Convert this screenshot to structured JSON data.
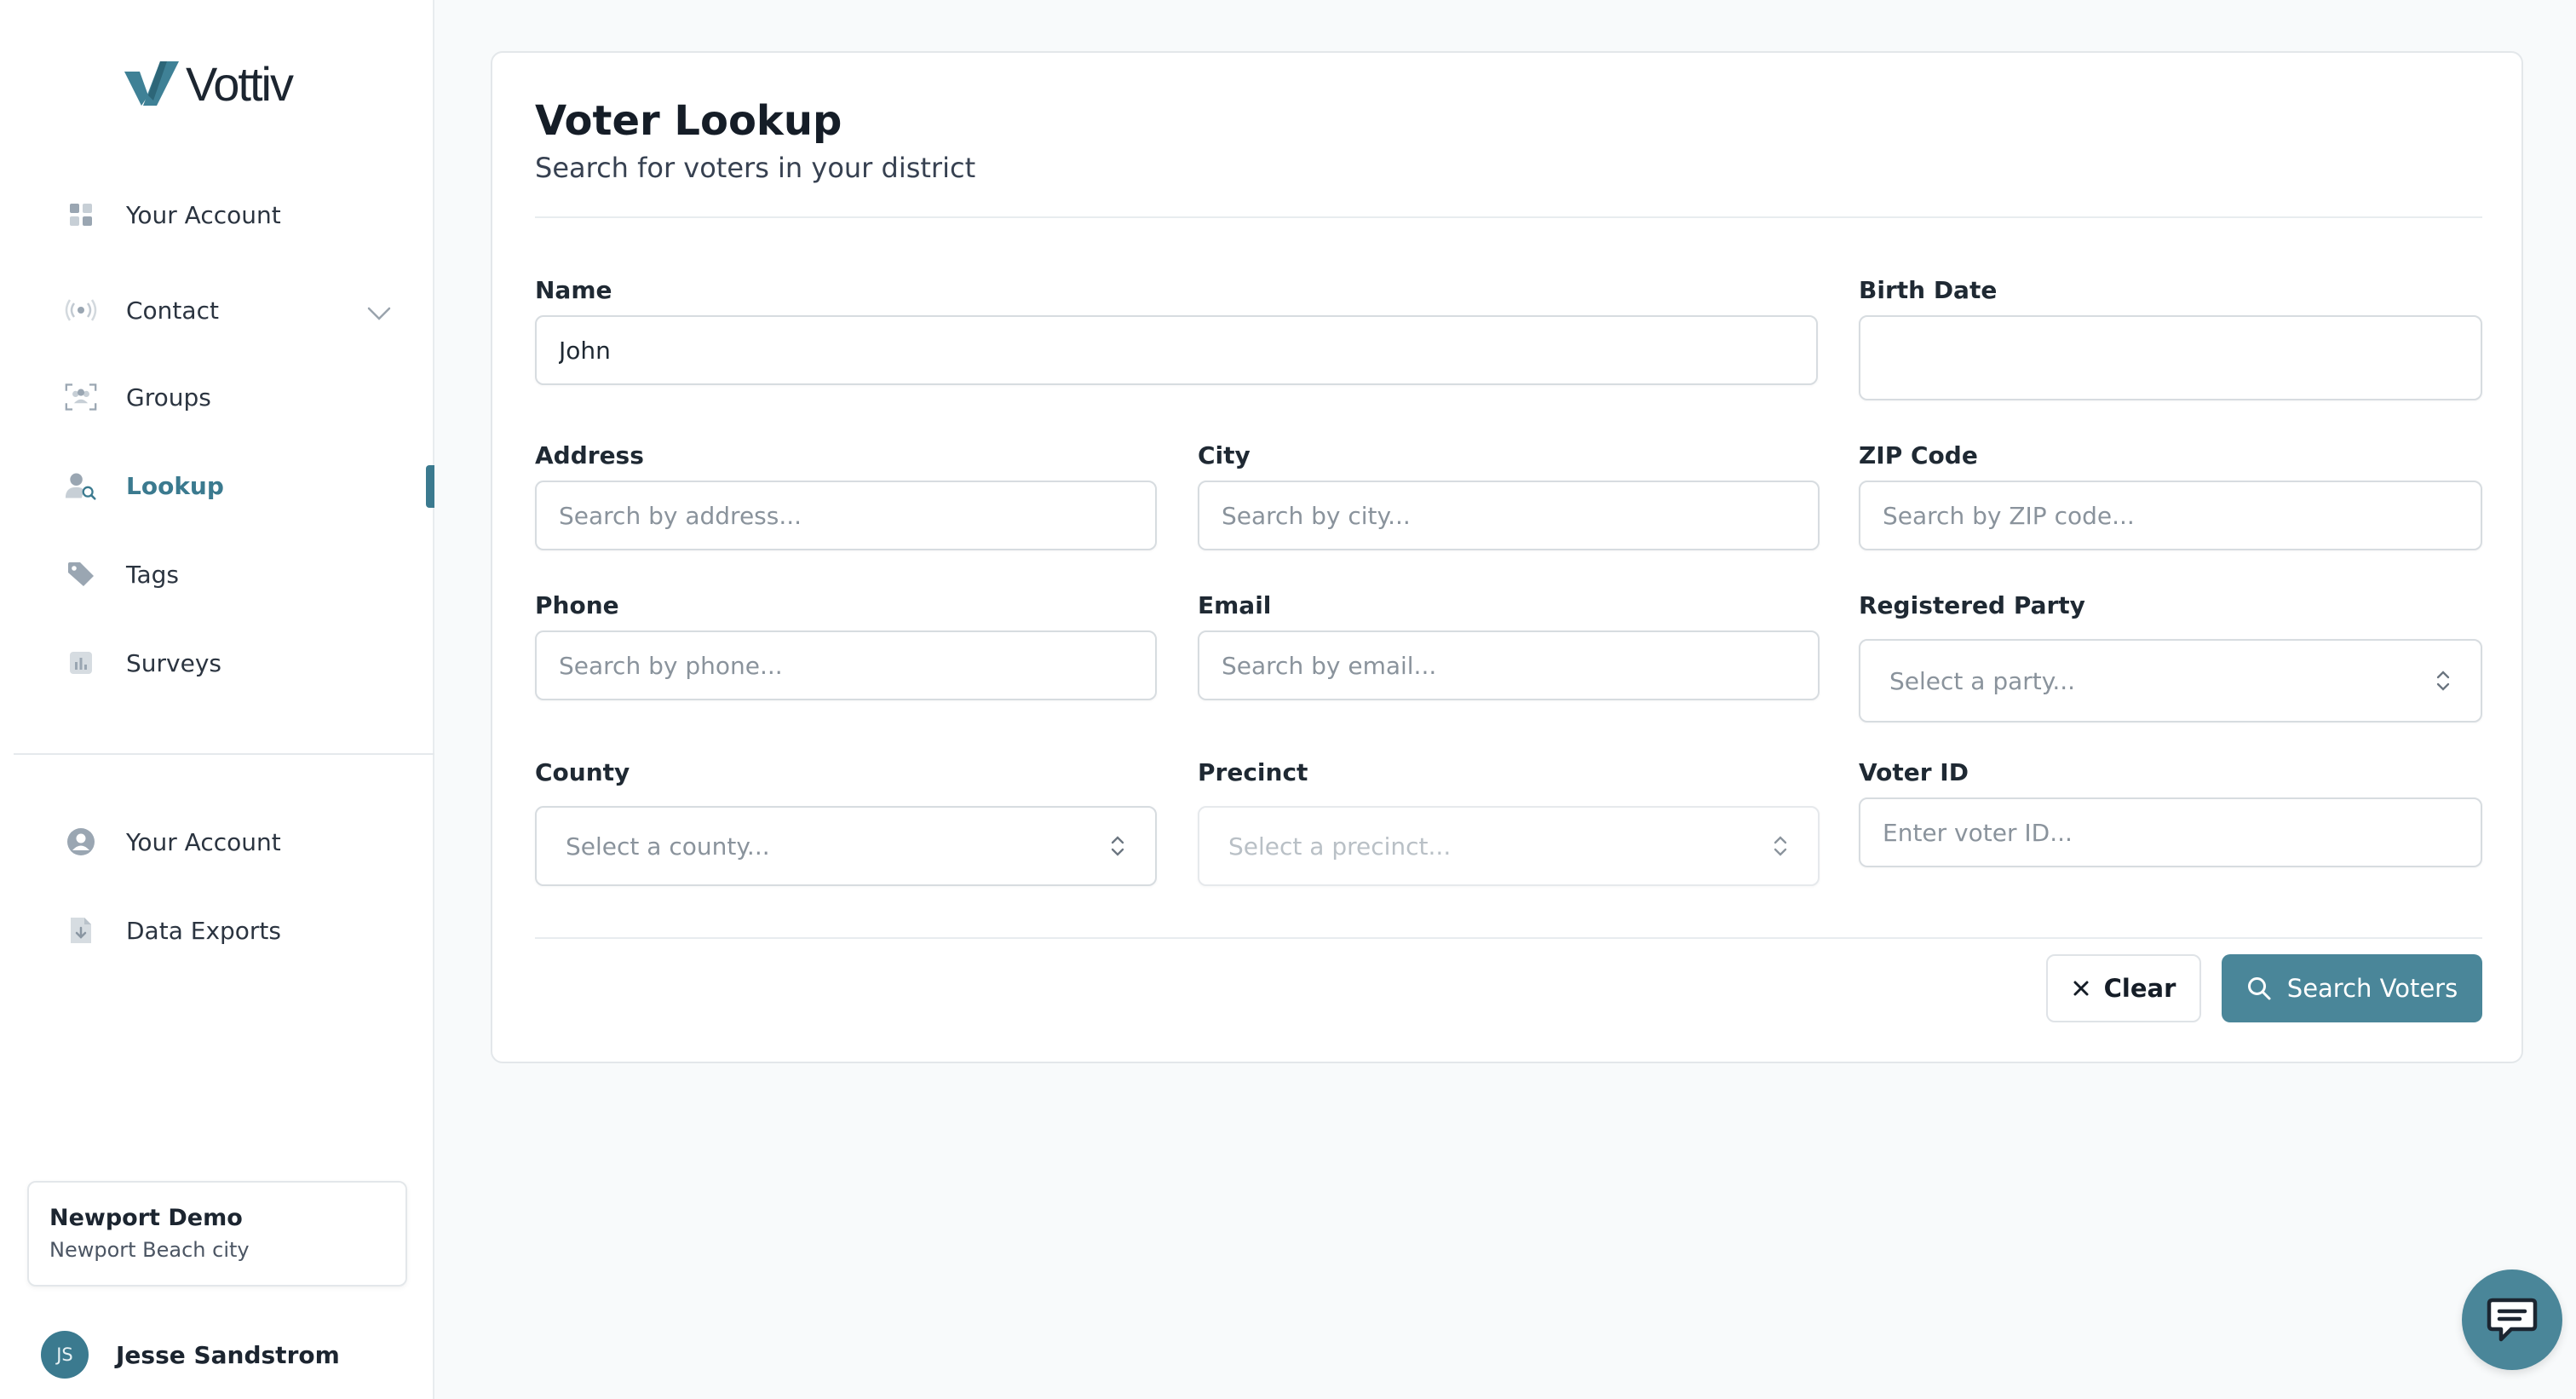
{
  "brand": {
    "name": "Vottiv",
    "accent": "#4a8699",
    "accent_dark": "#3b7a8f"
  },
  "sidebar": {
    "items": [
      {
        "label": "Your Account",
        "icon": "dashboard-grid-icon"
      },
      {
        "label": "Contact",
        "icon": "broadcast-icon"
      },
      {
        "label": "Groups",
        "icon": "groups-icon"
      },
      {
        "label": "Lookup",
        "icon": "person-search-icon",
        "active": true
      },
      {
        "label": "Tags",
        "icon": "tag-icon"
      },
      {
        "label": "Surveys",
        "icon": "bar-chart-icon"
      }
    ],
    "secondary_items": [
      {
        "label": "Your Account",
        "icon": "user-circle-icon"
      },
      {
        "label": "Data Exports",
        "icon": "file-download-icon"
      }
    ],
    "org": {
      "name": "Newport Demo",
      "subtitle": "Newport Beach city"
    },
    "user": {
      "initials": "JS",
      "name": "Jesse Sandstrom"
    }
  },
  "main": {
    "title": "Voter Lookup",
    "subtitle": "Search for voters in your district",
    "fields": {
      "name": {
        "label": "Name",
        "value": "John"
      },
      "birth_date": {
        "label": "Birth Date",
        "value": ""
      },
      "address": {
        "label": "Address",
        "placeholder": "Search by address..."
      },
      "city": {
        "label": "City",
        "placeholder": "Search by city..."
      },
      "zip": {
        "label": "ZIP Code",
        "placeholder": "Search by ZIP code..."
      },
      "phone": {
        "label": "Phone",
        "placeholder": "Search by phone..."
      },
      "email": {
        "label": "Email",
        "placeholder": "Search by email..."
      },
      "party": {
        "label": "Registered Party",
        "placeholder": "Select a party..."
      },
      "county": {
        "label": "County",
        "placeholder": "Select a county..."
      },
      "precinct": {
        "label": "Precinct",
        "placeholder": "Select a precinct..."
      },
      "voter_id": {
        "label": "Voter ID",
        "placeholder": "Enter voter ID..."
      }
    },
    "buttons": {
      "clear": "Clear",
      "search": "Search Voters"
    }
  }
}
